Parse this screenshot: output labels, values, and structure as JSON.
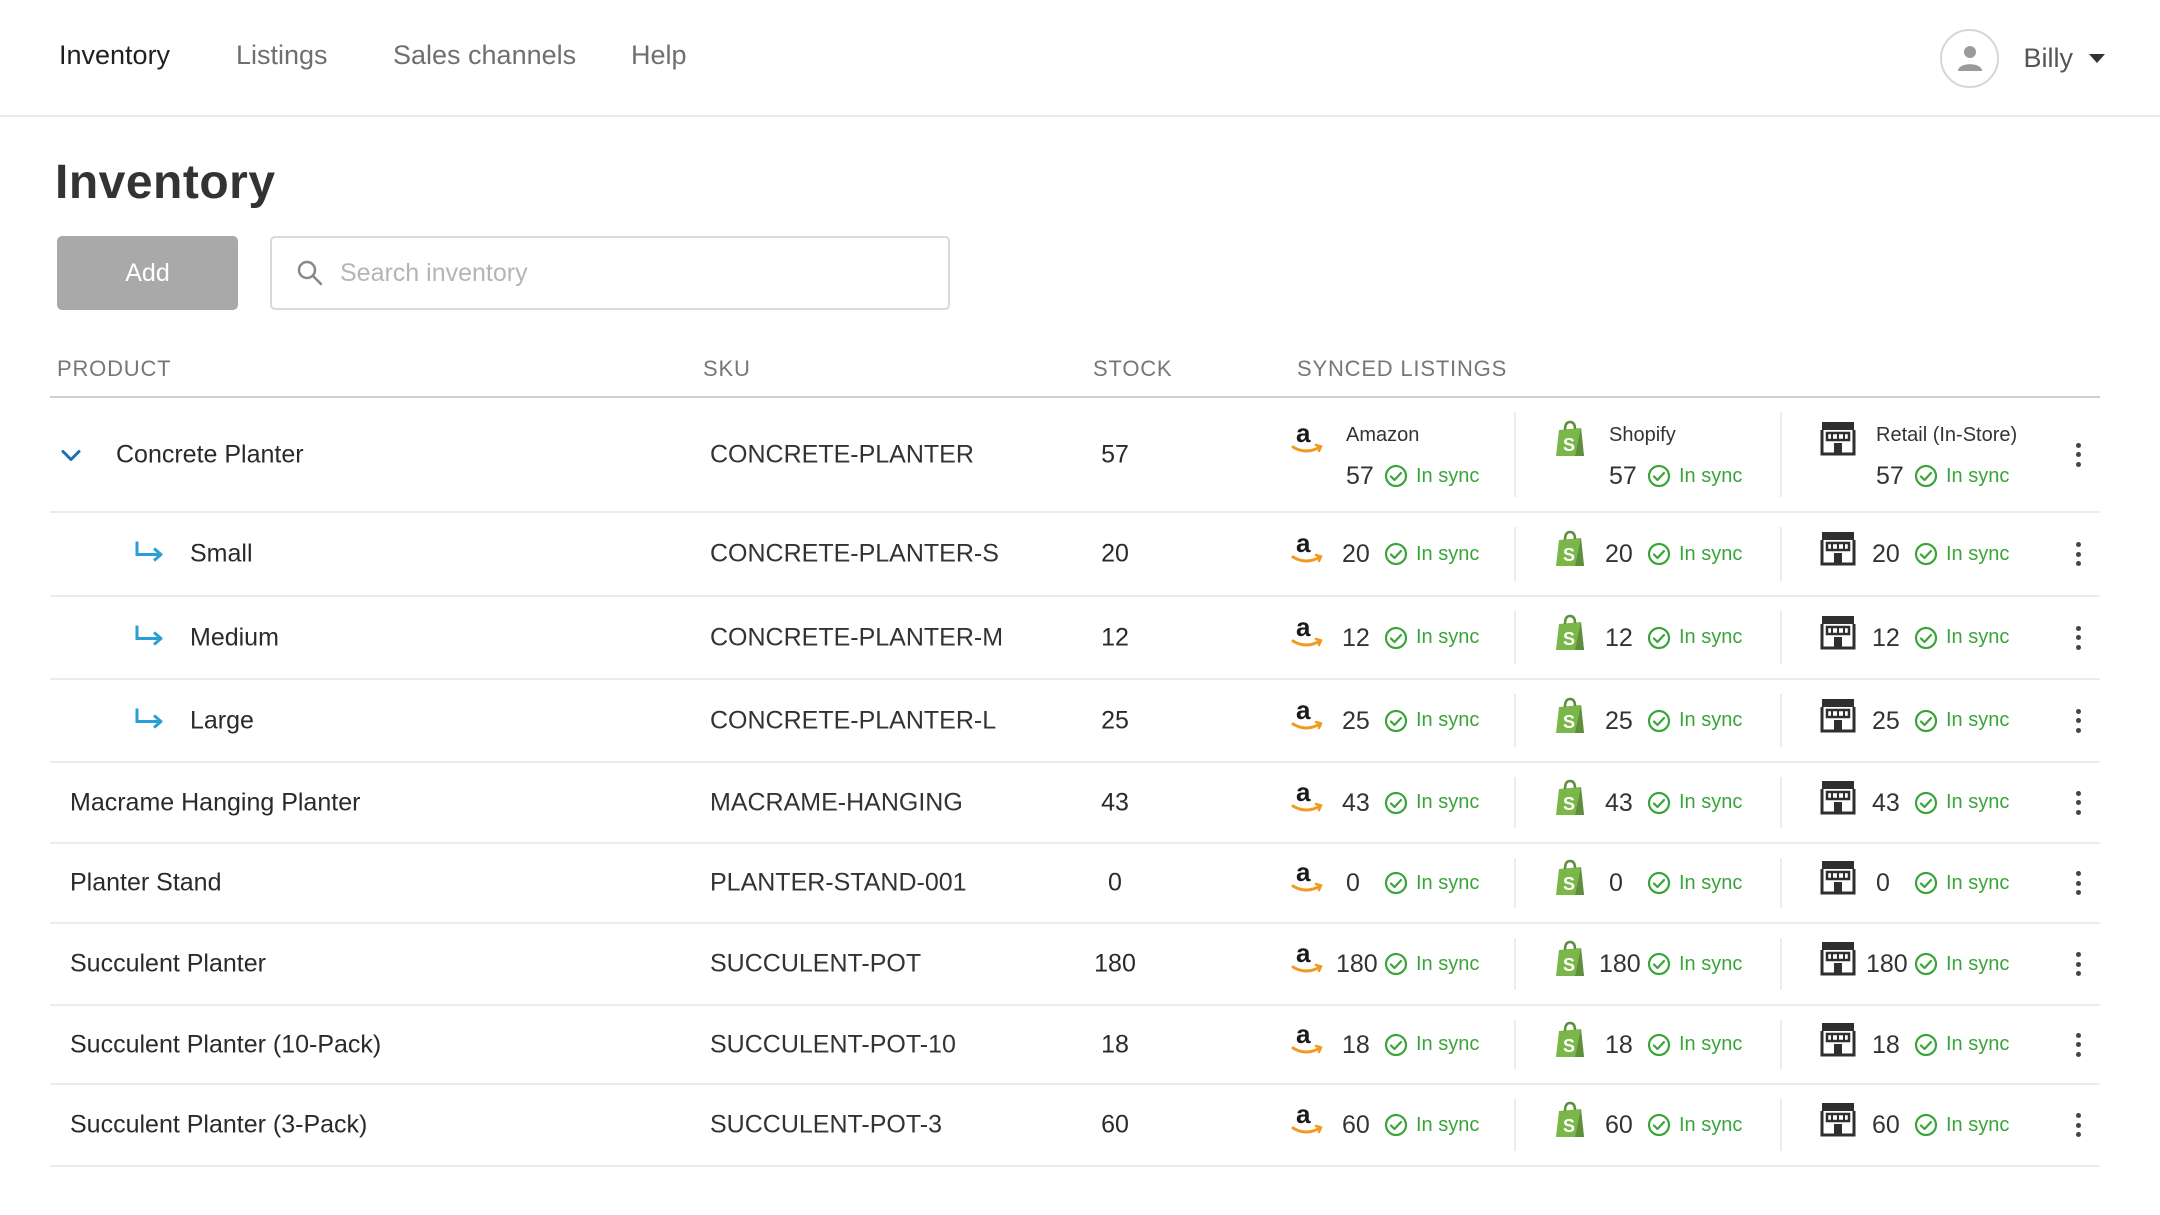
{
  "nav": {
    "items": [
      {
        "label": "Inventory",
        "active": true
      },
      {
        "label": "Listings",
        "active": false
      },
      {
        "label": "Sales channels",
        "active": false
      },
      {
        "label": "Help",
        "active": false
      }
    ],
    "user_name": "Billy"
  },
  "page": {
    "title": "Inventory",
    "add_label": "Add",
    "search_placeholder": "Search inventory"
  },
  "table": {
    "headers": {
      "product": "PRODUCT",
      "sku": "SKU",
      "stock": "STOCK",
      "synced": "SYNCED LISTINGS"
    },
    "channels": [
      {
        "name": "Amazon",
        "icon": "amazon-icon"
      },
      {
        "name": "Shopify",
        "icon": "shopify-icon"
      },
      {
        "name": "Retail (In-Store)",
        "icon": "store-icon"
      }
    ],
    "sync_label": "In sync",
    "colors": {
      "sync_green": "#3aa43a",
      "variant_arrow": "#2a9fd6",
      "expand_chevron": "#1a6fb0"
    },
    "rows": [
      {
        "product": "Concrete Planter",
        "sku": "CONCRETE-PLANTER",
        "stock": "57",
        "level": "parent",
        "expanded": true
      },
      {
        "product": "Small",
        "sku": "CONCRETE-PLANTER-S",
        "stock": "20",
        "level": "variant"
      },
      {
        "product": "Medium",
        "sku": "CONCRETE-PLANTER-M",
        "stock": "12",
        "level": "variant"
      },
      {
        "product": "Large",
        "sku": "CONCRETE-PLANTER-L",
        "stock": "25",
        "level": "variant"
      },
      {
        "product": "Macrame Hanging Planter",
        "sku": "MACRAME-HANGING",
        "stock": "43",
        "level": "top"
      },
      {
        "product": "Planter Stand",
        "sku": "PLANTER-STAND-001",
        "stock": "0",
        "level": "top"
      },
      {
        "product": "Succulent Planter",
        "sku": "SUCCULENT-POT",
        "stock": "180",
        "level": "top"
      },
      {
        "product": "Succulent Planter (10-Pack)",
        "sku": "SUCCULENT-POT-10",
        "stock": "18",
        "level": "top"
      },
      {
        "product": "Succulent Planter (3-Pack)",
        "sku": "SUCCULENT-POT-3",
        "stock": "60",
        "level": "top"
      }
    ]
  }
}
